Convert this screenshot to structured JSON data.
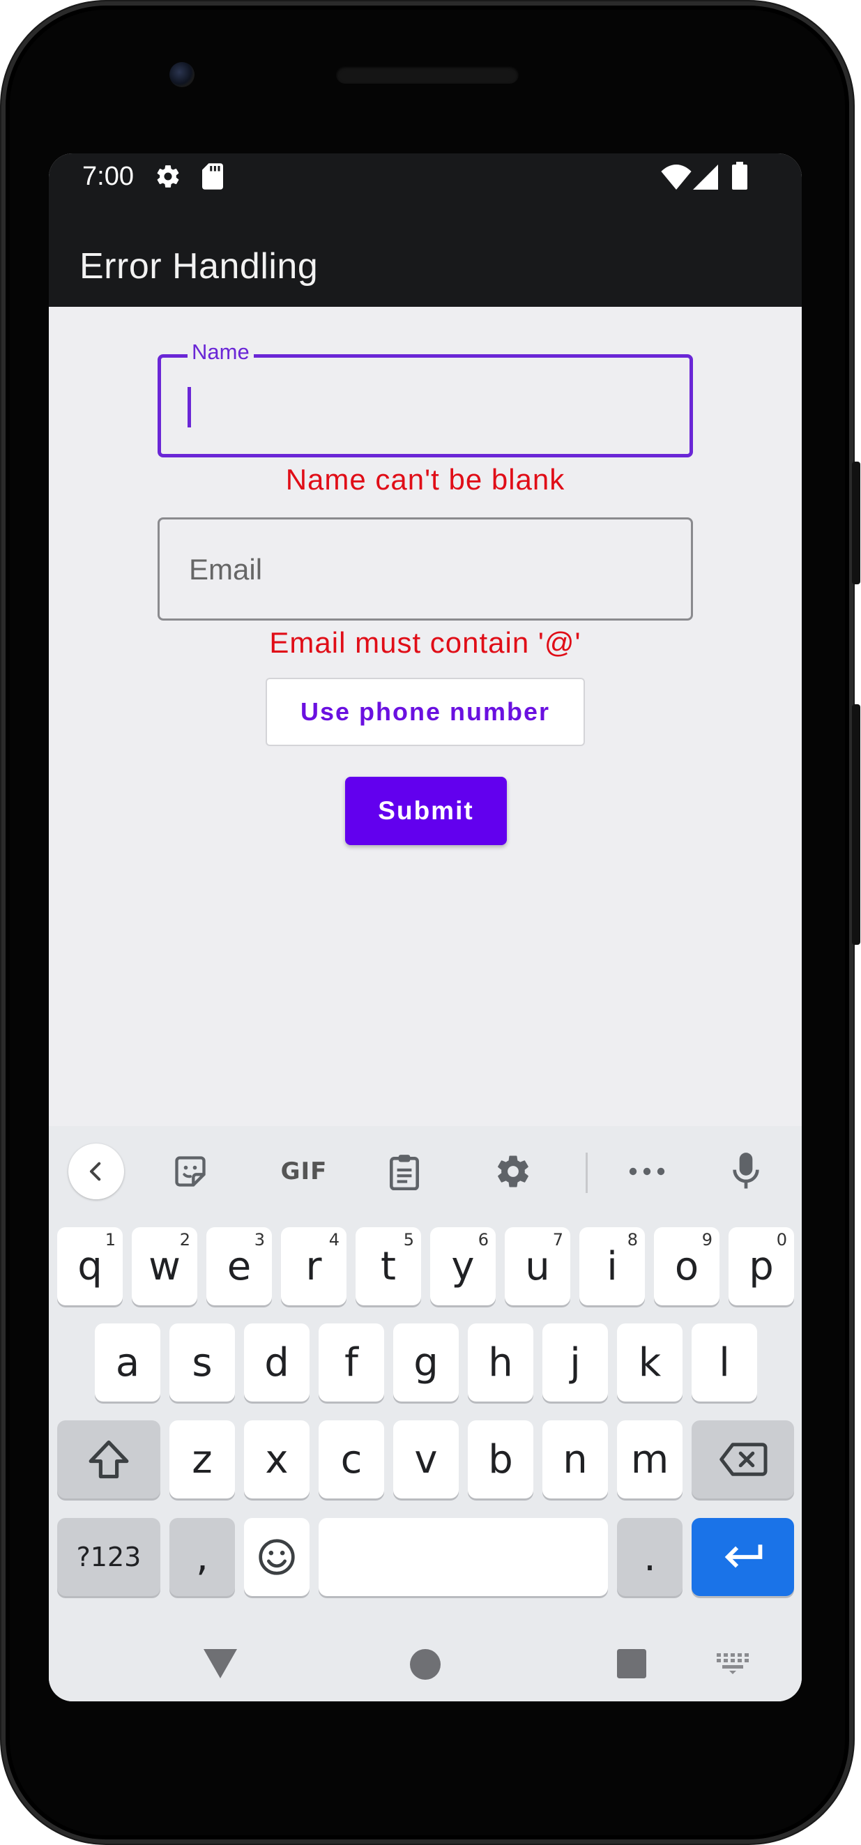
{
  "status_bar": {
    "time": "7:00",
    "icons": [
      "gear-icon",
      "sd-card-icon",
      "wifi-icon",
      "signal-icon",
      "battery-icon"
    ]
  },
  "app_bar": {
    "title": "Error Handling"
  },
  "form": {
    "name_field": {
      "label": "Name",
      "value": "",
      "error": "Name can't be blank"
    },
    "email_field": {
      "placeholder": "Email",
      "value": "",
      "error": "Email must contain '@'"
    },
    "use_phone_label": "Use phone number",
    "submit_label": "Submit"
  },
  "keyboard": {
    "toolbar": {
      "items": [
        "back-chevron-icon",
        "sticker-icon",
        "gif-icon",
        "clipboard-icon",
        "gear-icon",
        "more-icon",
        "microphone-icon"
      ],
      "gif_label": "GIF"
    },
    "row1": [
      {
        "key": "q",
        "hint": "1"
      },
      {
        "key": "w",
        "hint": "2"
      },
      {
        "key": "e",
        "hint": "3"
      },
      {
        "key": "r",
        "hint": "4"
      },
      {
        "key": "t",
        "hint": "5"
      },
      {
        "key": "y",
        "hint": "6"
      },
      {
        "key": "u",
        "hint": "7"
      },
      {
        "key": "i",
        "hint": "8"
      },
      {
        "key": "o",
        "hint": "9"
      },
      {
        "key": "p",
        "hint": "0"
      }
    ],
    "row2": [
      "a",
      "s",
      "d",
      "f",
      "g",
      "h",
      "j",
      "k",
      "l"
    ],
    "row3": [
      "z",
      "x",
      "c",
      "v",
      "b",
      "n",
      "m"
    ],
    "row4": {
      "symbols": "?123",
      "comma": ",",
      "period": "."
    }
  },
  "colors": {
    "accent": "#6200ee",
    "focus_border": "#6a26d6",
    "error": "#e00d17",
    "enter_key": "#1a73e8",
    "app_bar": "#18191b"
  }
}
